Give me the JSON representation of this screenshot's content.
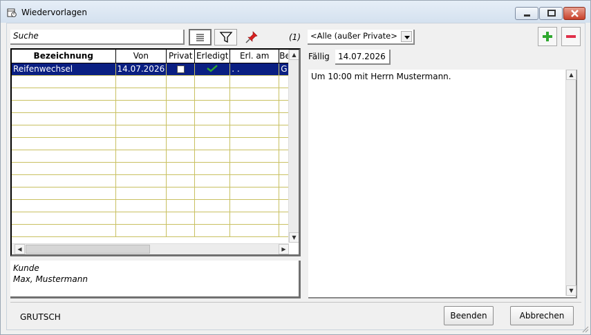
{
  "window": {
    "title": "Wiedervorlagen"
  },
  "toolbar": {
    "search_value": "Suche",
    "count": "(1)",
    "filter_select_value": "<Alle (außer Private>"
  },
  "grid": {
    "columns": [
      "Bezeichnung",
      "Von",
      "Privat",
      "Erledigt",
      "Erl. am",
      "Be"
    ],
    "rows": [
      {
        "bezeichnung": "Reifenwechsel",
        "von": "14.07.2026",
        "privat": false,
        "erledigt": true,
        "erl_am": ". .",
        "be": "G"
      }
    ]
  },
  "customer": {
    "label": "Kunde",
    "name": "Max, Mustermann"
  },
  "detail": {
    "due_label": "Fällig",
    "due_value": "14.07.2026",
    "memo": "Um 10:00 mit Herrn Mustermann."
  },
  "footer": {
    "user": "GRUTSCH",
    "end_label": "Beenden",
    "cancel_label": "Abbrechen"
  },
  "colors": {
    "selection": "#0a1f82",
    "grid_lines": "#c8c060",
    "plus": "#2fa82f",
    "minus": "#e0304a"
  }
}
